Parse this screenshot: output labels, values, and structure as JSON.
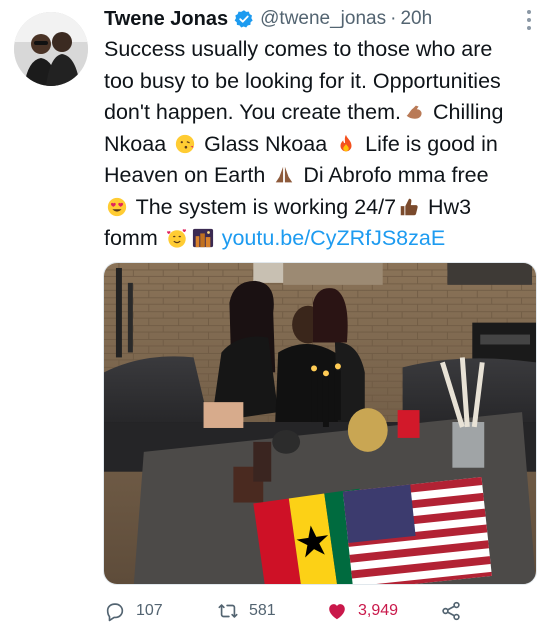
{
  "tweet": {
    "display_name": "Twene Jonas",
    "handle": "@twene_jonas",
    "time": "20h",
    "lines": [
      {
        "parts": [
          {
            "t": "Success usually comes to those who are"
          }
        ]
      },
      {
        "parts": [
          {
            "t": "too busy to be looking for it. Opportunities"
          }
        ]
      },
      {
        "parts": [
          {
            "t": "don't happen. You create them."
          },
          {
            "e": "flexed-biceps-emoji"
          },
          {
            "t": " Chilling"
          }
        ]
      },
      {
        "parts": [
          {
            "t": "Nkoaa "
          },
          {
            "e": "kissing-face-emoji"
          },
          {
            "t": " Glass Nkoaa "
          },
          {
            "e": "fire-emoji"
          },
          {
            "t": " Life is good in"
          }
        ]
      },
      {
        "parts": [
          {
            "t": "Heaven on Earth "
          },
          {
            "e": "folded-hands-emoji"
          },
          {
            "t": " Di Abrofo mma free"
          }
        ]
      },
      {
        "parts": [
          {
            "e": "heart-eyes-emoji"
          },
          {
            "t": " The system is working 24/7"
          },
          {
            "e": "thumbs-up-emoji"
          },
          {
            "t": " Hw3"
          }
        ]
      },
      {
        "parts": [
          {
            "t": "fomm "
          },
          {
            "e": "smiling-hearts-emoji"
          },
          {
            "e": "night-city-emoji"
          },
          {
            "t": " "
          },
          {
            "link": "youtu.be/CyZRfJS8zaE"
          }
        ]
      }
    ]
  },
  "actions": {
    "replies": "107",
    "retweets": "581",
    "likes": "3,949"
  },
  "colors": {
    "link": "#1d9bf0",
    "secondary_text": "#536471",
    "like": "#c9184a",
    "verified": "#1d9bf0"
  },
  "icons": [
    "reply-icon",
    "retweet-icon",
    "heart-icon",
    "share-icon",
    "verified-badge-icon",
    "more-options-icon"
  ]
}
